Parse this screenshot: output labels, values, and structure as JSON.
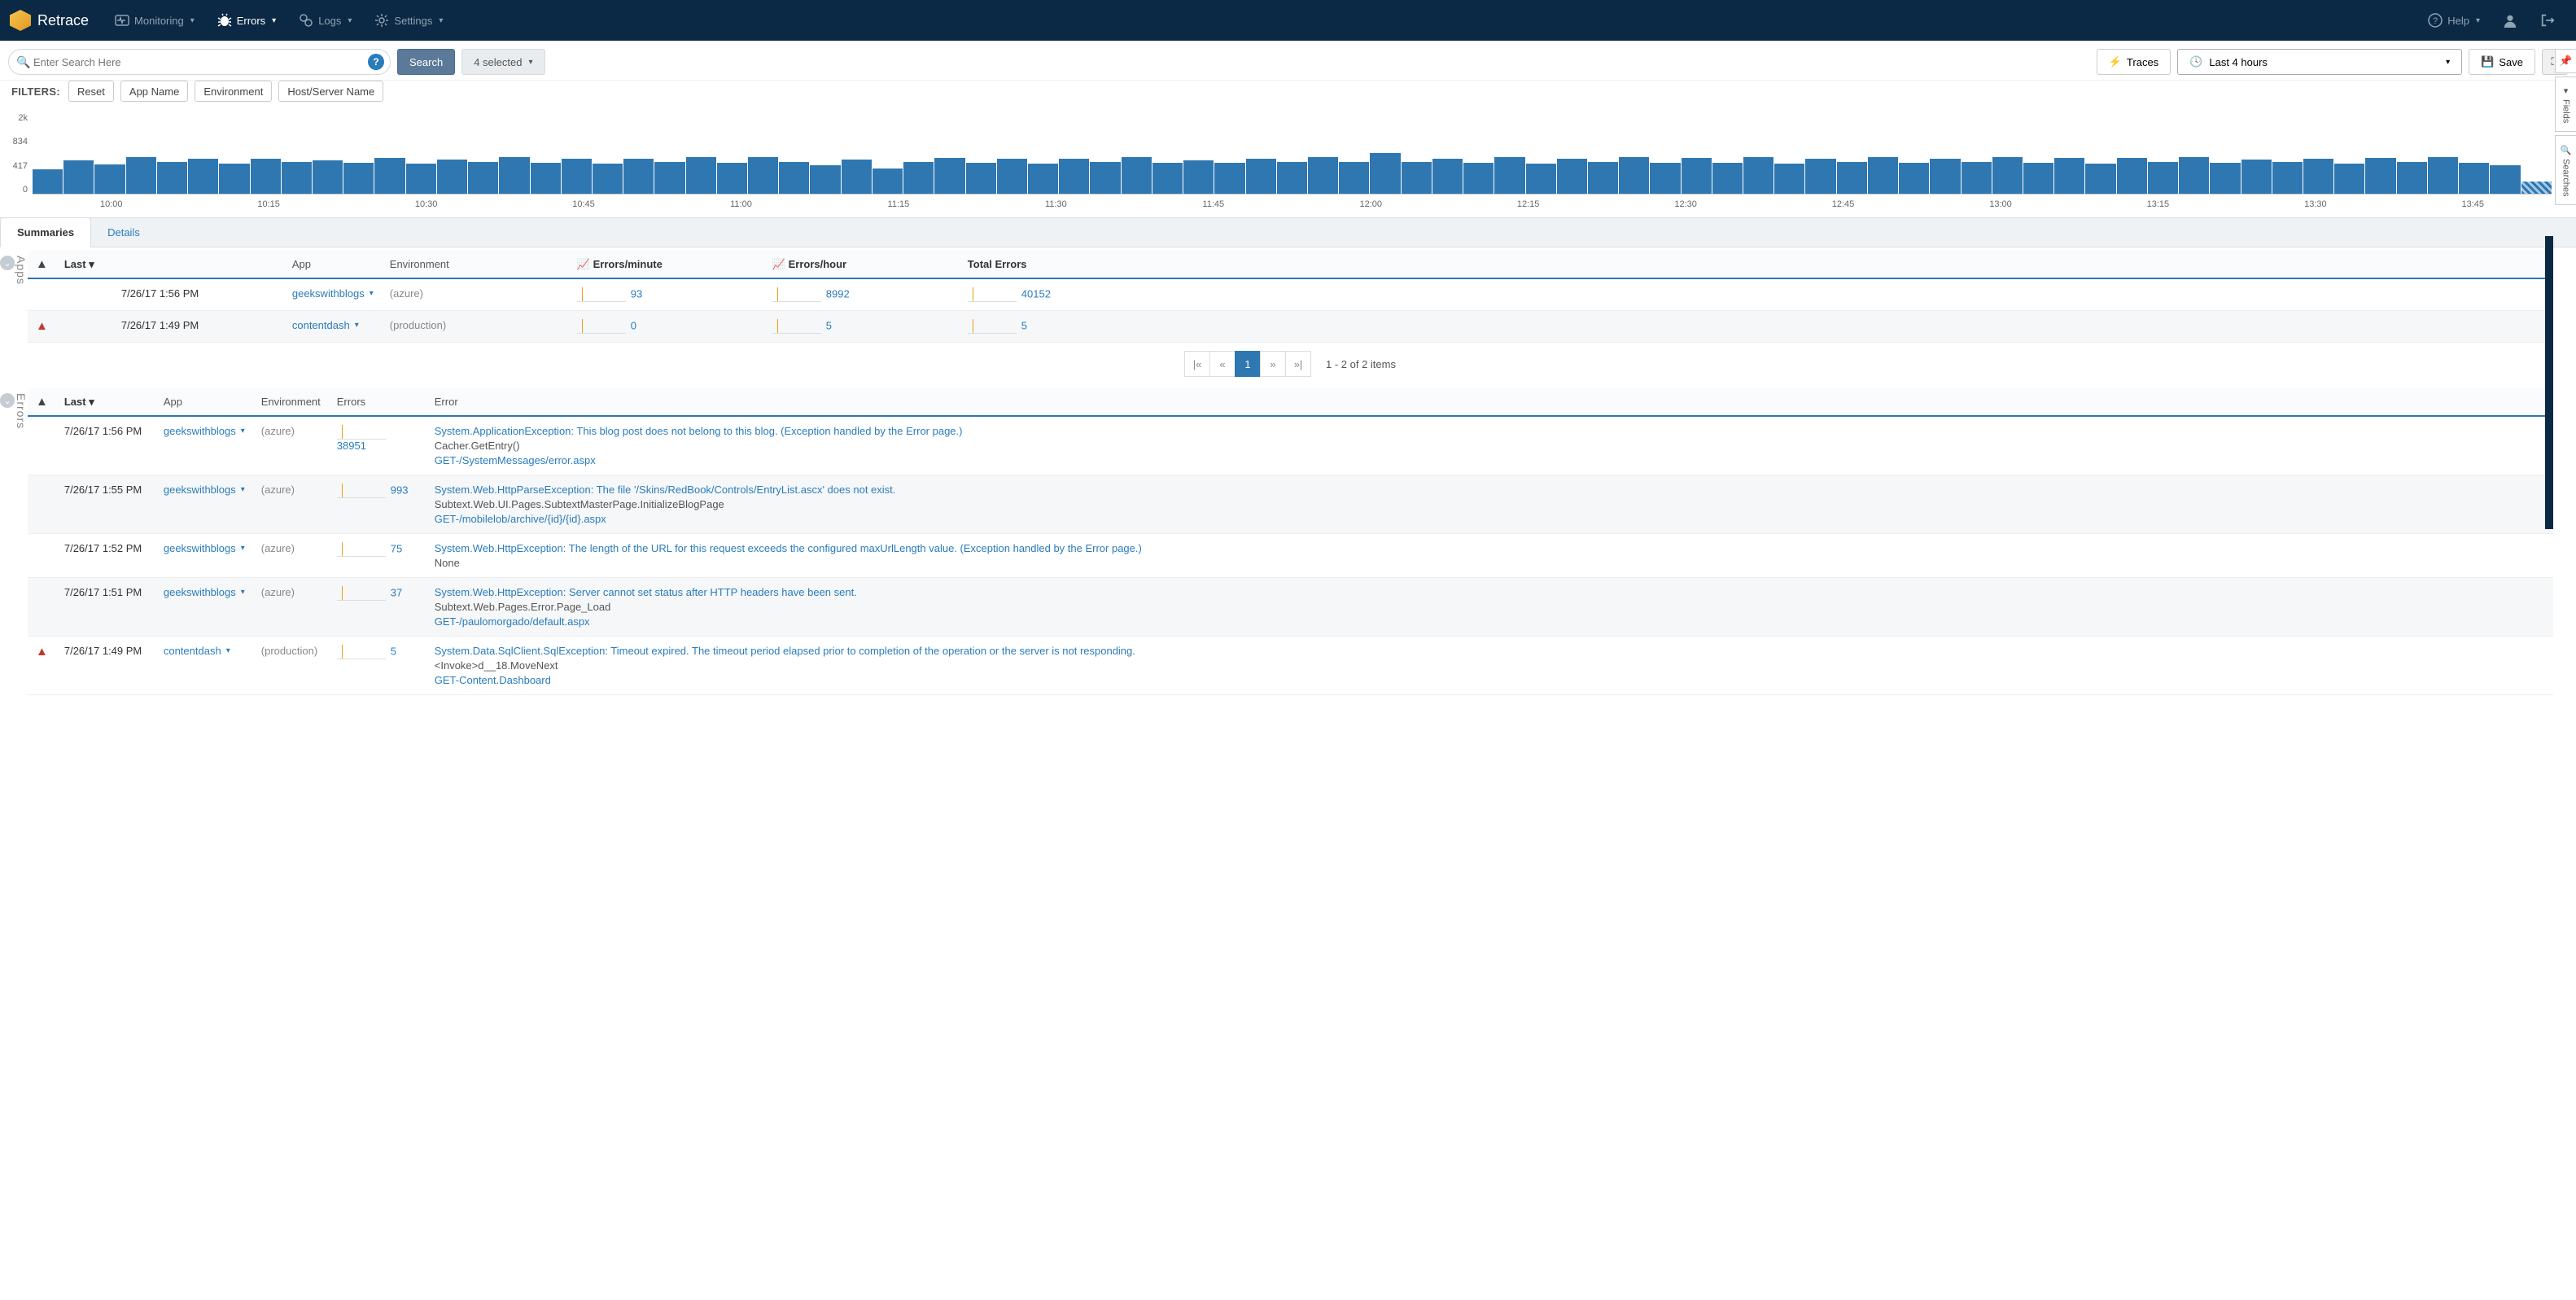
{
  "nav": {
    "brand": "Retrace",
    "items": [
      {
        "label": "Monitoring",
        "icon": "pulse-icon",
        "active": false
      },
      {
        "label": "Errors",
        "icon": "bug-icon",
        "active": true
      },
      {
        "label": "Logs",
        "icon": "gears-icon",
        "active": false
      },
      {
        "label": "Settings",
        "icon": "gear-icon",
        "active": false
      }
    ],
    "help": "Help"
  },
  "toolbar": {
    "search_placeholder": "Enter Search Here",
    "search_btn": "Search",
    "selected": "4 selected",
    "traces": "Traces",
    "timerange": "Last 4 hours",
    "save": "Save"
  },
  "filters": {
    "label": "FILTERS:",
    "reset": "Reset",
    "tokens": [
      "App Name",
      "Environment",
      "Host/Server Name"
    ]
  },
  "rail": {
    "fields": "Fields",
    "searches": "Searches"
  },
  "chart_data": {
    "type": "bar",
    "ylim": [
      0,
      2000
    ],
    "yticks": [
      0,
      417,
      834,
      "2k"
    ],
    "xticks": [
      "10:00",
      "10:15",
      "10:30",
      "10:45",
      "11:00",
      "11:15",
      "11:30",
      "11:45",
      "12:00",
      "12:15",
      "12:30",
      "12:45",
      "13:00",
      "13:15",
      "13:30",
      "13:45"
    ],
    "values": [
      600,
      820,
      720,
      900,
      790,
      860,
      740,
      870,
      780,
      830,
      760,
      880,
      750,
      850,
      780,
      900,
      760,
      870,
      740,
      860,
      780,
      900,
      770,
      910,
      790,
      700,
      850,
      620,
      790,
      880,
      760,
      870,
      750,
      860,
      780,
      900,
      770,
      830,
      760,
      870,
      790,
      910,
      780,
      1010,
      790,
      870,
      760,
      900,
      750,
      870,
      780,
      900,
      760,
      880,
      770,
      900,
      750,
      870,
      780,
      900,
      760,
      870,
      780,
      900,
      770,
      880,
      750,
      890,
      780,
      900,
      760,
      840,
      780,
      870,
      750,
      890,
      780,
      900,
      760,
      700,
      300
    ]
  },
  "tabs": {
    "summaries": "Summaries",
    "details": "Details"
  },
  "apps_table": {
    "section": "Apps",
    "headers": {
      "warn": "",
      "last": "Last ▾",
      "app": "App",
      "env": "Environment",
      "epm": "Errors/minute",
      "eph": "Errors/hour",
      "total": "Total Errors"
    },
    "rows": [
      {
        "warn": false,
        "last": "7/26/17 1:56 PM",
        "app": "geekswithblogs",
        "env": "(azure)",
        "epm": "93",
        "eph": "8992",
        "total": "40152"
      },
      {
        "warn": true,
        "last": "7/26/17 1:49 PM",
        "app": "contentdash",
        "env": "(production)",
        "epm": "0",
        "eph": "5",
        "total": "5"
      }
    ],
    "pag": {
      "current": "1",
      "info": "1 - 2 of 2 items"
    }
  },
  "errors_table": {
    "section": "Errors",
    "headers": {
      "warn": "",
      "last": "Last ▾",
      "app": "App",
      "env": "Environment",
      "errors": "Errors",
      "error": "Error"
    },
    "rows": [
      {
        "warn": false,
        "last": "7/26/17 1:56 PM",
        "app": "geekswithblogs",
        "env": "(azure)",
        "count": "38951",
        "title": "System.ApplicationException: This blog post does not belong to this blog. (Exception handled by the Error page.)",
        "sub": "Cacher.GetEntry()",
        "get": "GET-/SystemMessages/error.aspx"
      },
      {
        "warn": false,
        "last": "7/26/17 1:55 PM",
        "app": "geekswithblogs",
        "env": "(azure)",
        "count": "993",
        "title": "System.Web.HttpParseException: The file '/Skins/RedBook/Controls/EntryList.ascx' does not exist.",
        "sub": "Subtext.Web.UI.Pages.SubtextMasterPage.InitializeBlogPage",
        "get": "GET-/mobilelob/archive/{id}/{id}.aspx"
      },
      {
        "warn": false,
        "last": "7/26/17 1:52 PM",
        "app": "geekswithblogs",
        "env": "(azure)",
        "count": "75",
        "title": "System.Web.HttpException: The length of the URL for this request exceeds the configured maxUrlLength value. (Exception handled by the Error page.)",
        "sub": "None",
        "get": ""
      },
      {
        "warn": false,
        "last": "7/26/17 1:51 PM",
        "app": "geekswithblogs",
        "env": "(azure)",
        "count": "37",
        "title": "System.Web.HttpException: Server cannot set status after HTTP headers have been sent.",
        "sub": "Subtext.Web.Pages.Error.Page_Load",
        "get": "GET-/paulomorgado/default.aspx"
      },
      {
        "warn": true,
        "last": "7/26/17 1:49 PM",
        "app": "contentdash",
        "env": "(production)",
        "count": "5",
        "title": "System.Data.SqlClient.SqlException: Timeout expired. The timeout period elapsed prior to completion of the operation or the server is not responding.",
        "sub": "<Invoke>d__18.MoveNext",
        "get": "GET-Content.Dashboard"
      }
    ]
  }
}
